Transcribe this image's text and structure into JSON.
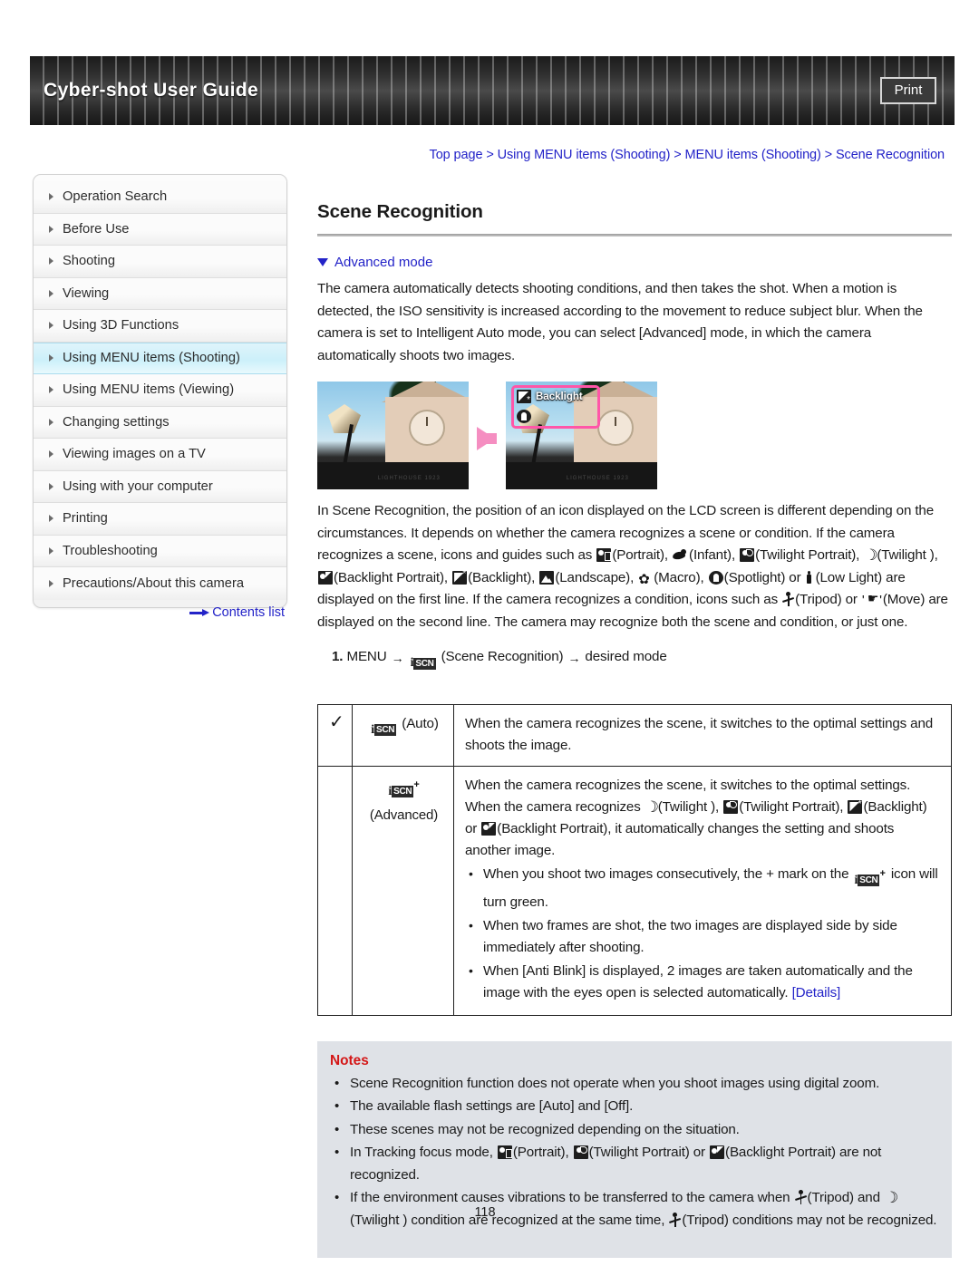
{
  "header": {
    "title": "Cyber-shot User Guide",
    "print_label": "Print"
  },
  "breadcrumb": {
    "text": "Top page > Using MENU items (Shooting) > MENU items (Shooting) > Scene Recognition"
  },
  "sidebar": {
    "items": [
      {
        "label": "Operation Search",
        "active": false
      },
      {
        "label": "Before Use",
        "active": false
      },
      {
        "label": "Shooting",
        "active": false
      },
      {
        "label": "Viewing",
        "active": false
      },
      {
        "label": "Using 3D Functions",
        "active": false
      },
      {
        "label": "Using MENU items (Shooting)",
        "active": true
      },
      {
        "label": "Using MENU items (Viewing)",
        "active": false
      },
      {
        "label": "Changing settings",
        "active": false
      },
      {
        "label": "Viewing images on a TV",
        "active": false
      },
      {
        "label": "Using with your computer",
        "active": false
      },
      {
        "label": "Printing",
        "active": false
      },
      {
        "label": "Troubleshooting",
        "active": false
      },
      {
        "label": "Precautions/About this camera",
        "active": false
      }
    ],
    "contents_link": "Contents list"
  },
  "main": {
    "title": "Scene Recognition",
    "subhead": "Advanced mode",
    "intro": "The camera automatically detects shooting conditions, and then takes the shot. When a motion is detected, the ISO sensitivity is increased according to the movement to reduce subject blur. When the camera is set to Intelligent Auto mode, you can select [Advanced] mode, in which the camera automatically shoots two images.",
    "figure": {
      "lcd_label": "Backlight",
      "base_text": "LIGHTHOUSE 1923"
    },
    "para2_a": "In Scene Recognition, the position of an icon displayed on the LCD screen is different depending on the circumstances. It depends on whether the camera recognizes a scene or condition. If the camera recognizes a scene, icons and guides such as",
    "para2_portrait": "(Portrait),",
    "para2_infant": "(Infant),",
    "para2_twiportrait": "(Twilight Portrait),",
    "para2_twilight": "(Twilight ),",
    "para2_blportrait": "(Backlight Portrait),",
    "para2_backlight": "(Backlight),",
    "para2_landscape": "(Landscape),",
    "para2_macro": "(Macro),",
    "para2_spotlight": "(Spotlight) or",
    "para2_lowlight": "(Low Light) are displayed on the first line. If the camera recognizes a condition, icons such as",
    "para2_tripod": "(Tripod) or",
    "para2_move": "(Move) are displayed on the second line. The camera may recognize both the scene and condition, or just one.",
    "step": {
      "number": "1.",
      "menu": "MENU",
      "arrow1": "→",
      "scene_recognition": "(Scene Recognition)",
      "arrow2": "→",
      "desired": "desired mode"
    }
  },
  "table": {
    "rows": [
      {
        "check": "✓",
        "mode_label": "(Auto)",
        "mode_plus": false,
        "body": "When the camera recognizes the scene, it switches to the optimal settings and shoots the image.",
        "bullets": []
      },
      {
        "check": "",
        "mode_label": "(Advanced)",
        "mode_plus": true,
        "body_a": "When the camera recognizes the scene, it switches to the optimal settings. When the camera recognizes",
        "body_twilight": "(Twilight ),",
        "body_twiportrait": "(Twilight Portrait),",
        "body_backlight": "(Backlight) or",
        "body_blportrait": "(Backlight Portrait), it automatically changes the setting and shoots another image.",
        "bullets": [
          {
            "pre": "When you shoot two images consecutively, the + mark on the",
            "post": "icon will turn green.",
            "has_icon": true
          },
          {
            "pre": "When two frames are shot, the two images are displayed side by side immediately after shooting.",
            "post": "",
            "has_icon": false
          },
          {
            "pre": "When [Anti Blink] is displayed, 2 images are taken automatically and the image with the eyes open is selected automatically.",
            "post": "",
            "has_icon": false,
            "link": "[Details]"
          }
        ]
      }
    ]
  },
  "notes": {
    "title": "Notes",
    "items": [
      {
        "text": "Scene Recognition function does not operate when you shoot images using digital zoom."
      },
      {
        "text": "The available flash settings are [Auto] and [Off]."
      },
      {
        "text": "These scenes may not be recognized depending on the situation."
      },
      {
        "pre": "In Tracking focus mode,",
        "mid1": "(Portrait),",
        "mid2": "(Twilight Portrait) or",
        "post": "(Backlight Portrait) are not recognized."
      },
      {
        "pre": "If the environment causes vibrations to be transferred to the camera when",
        "mid1": "(Tripod) and",
        "mid2": "(Twilight ) condition are recognized at the same time,",
        "post": "(Tripod) conditions may not be recognized."
      }
    ]
  },
  "footer": {
    "page_number": "118"
  },
  "colors": {
    "link": "#2323c8",
    "notes_title": "#d41717",
    "notes_bg": "#dfe2e7",
    "active_nav": "#ccf0fa",
    "highlight_box": "#ff56a8"
  }
}
